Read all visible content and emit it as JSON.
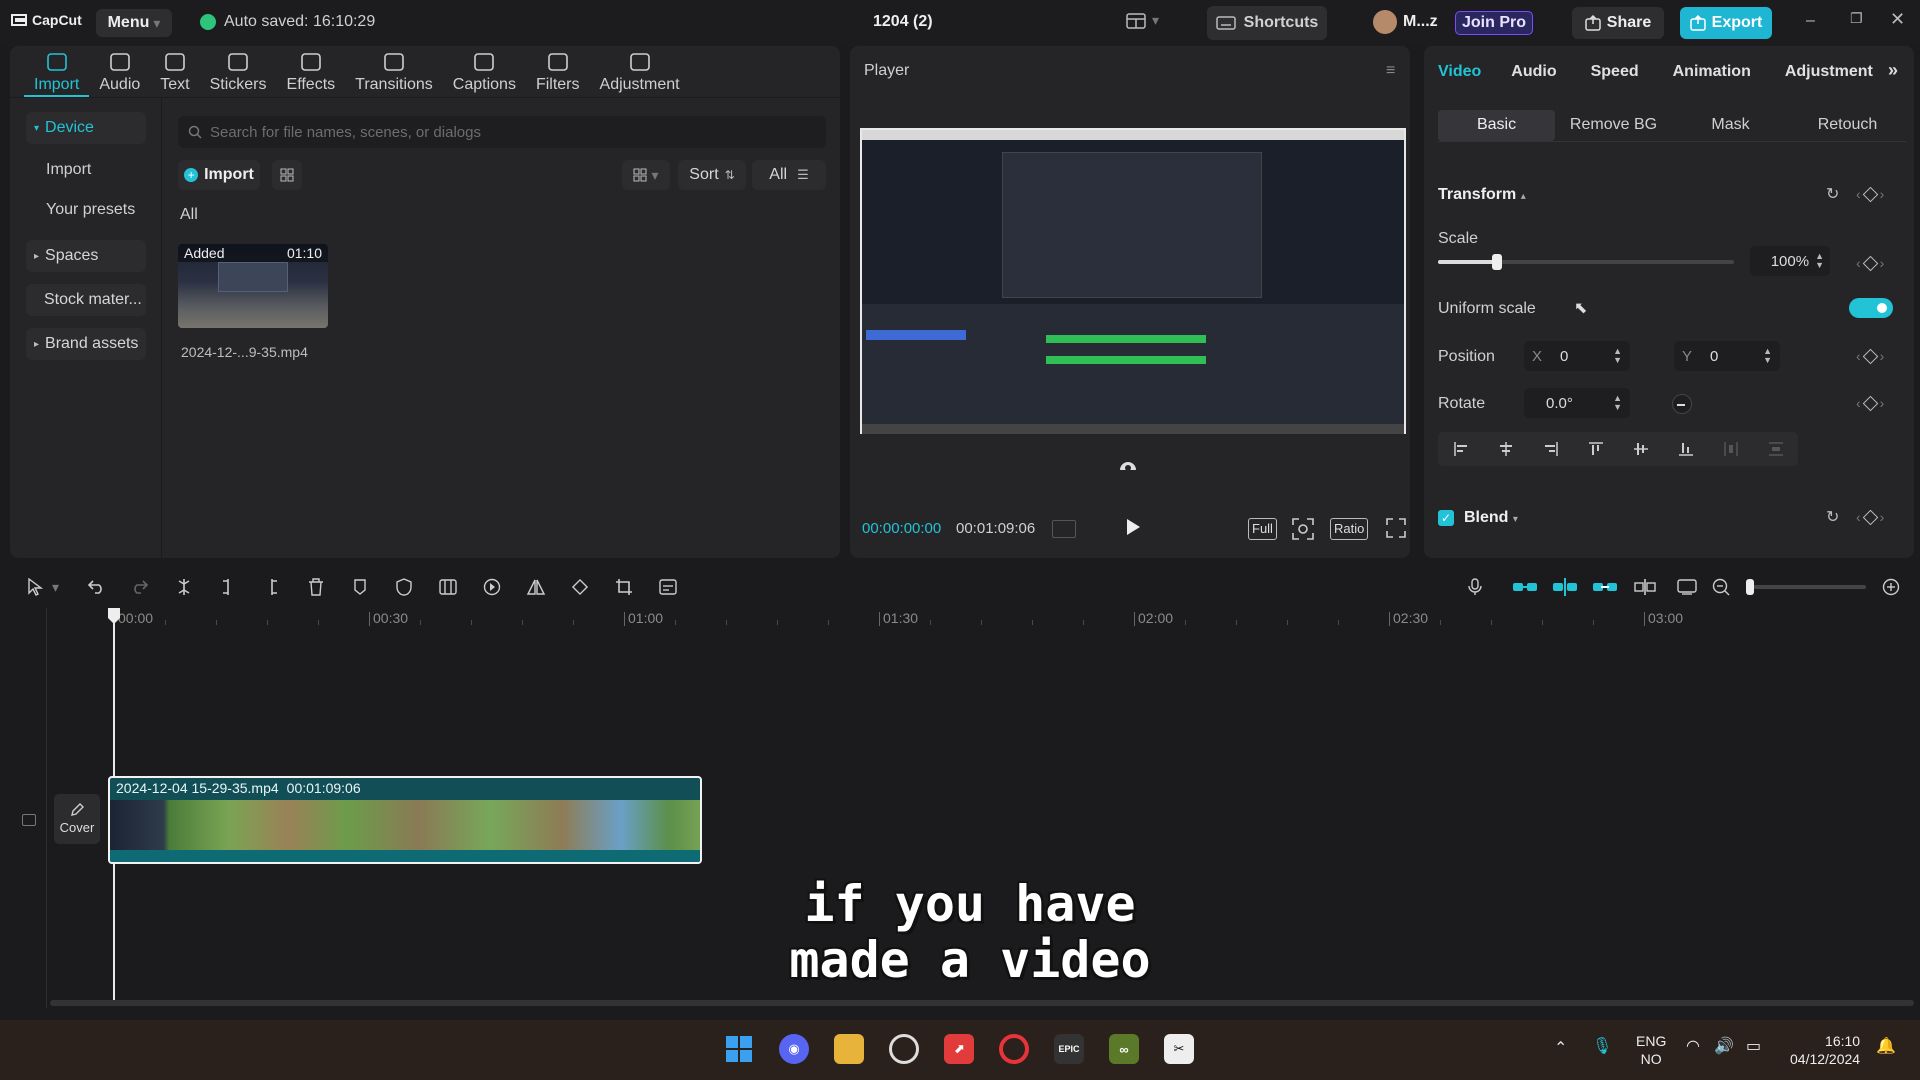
{
  "titlebar": {
    "app_name": "CapCut",
    "menu_label": "Menu",
    "autosave": "Auto saved: 16:10:29",
    "project_name": "1204 (2)",
    "shortcuts": "Shortcuts",
    "user": "M...z",
    "join_pro": "Join Pro",
    "share": "Share",
    "export": "Export"
  },
  "media_toolbar": [
    {
      "label": "Import",
      "icon": "import-icon"
    },
    {
      "label": "Audio",
      "icon": "audio-icon"
    },
    {
      "label": "Text",
      "icon": "text-icon"
    },
    {
      "label": "Stickers",
      "icon": "stickers-icon"
    },
    {
      "label": "Effects",
      "icon": "effects-icon"
    },
    {
      "label": "Transitions",
      "icon": "transitions-icon"
    },
    {
      "label": "Captions",
      "icon": "captions-icon"
    },
    {
      "label": "Filters",
      "icon": "filters-icon"
    },
    {
      "label": "Adjustment",
      "icon": "adjustment-icon"
    }
  ],
  "media_sidebar": {
    "device": "Device",
    "import": "Import",
    "presets": "Your presets",
    "spaces": "Spaces",
    "stock": "Stock mater...",
    "brand": "Brand assets"
  },
  "media": {
    "search_placeholder": "Search for file names, scenes, or dialogs",
    "import_button": "Import",
    "sort": "Sort",
    "all_filter": "All",
    "section_all": "All",
    "clip": {
      "badge": "Added",
      "duration": "01:10",
      "name": "2024-12-...9-35.mp4"
    }
  },
  "player": {
    "title": "Player",
    "current_time": "00:00:00:00",
    "total_time": "00:01:09:06",
    "full": "Full",
    "ratio": "Ratio"
  },
  "inspector": {
    "tabs": [
      "Video",
      "Audio",
      "Speed",
      "Animation",
      "Adjustment"
    ],
    "subtabs": [
      "Basic",
      "Remove BG",
      "Mask",
      "Retouch"
    ],
    "transform": "Transform",
    "scale_label": "Scale",
    "scale_value": "100%",
    "scale_fraction": 0.2,
    "uniform_scale": "Uniform scale",
    "position_label": "Position",
    "x_label": "X",
    "x_value": "0",
    "y_label": "Y",
    "y_value": "0",
    "rotate_label": "Rotate",
    "rotate_value": "0.0°",
    "blend": "Blend"
  },
  "timeline": {
    "ruler": [
      "00:00",
      "00:30",
      "01:00",
      "01:30",
      "02:00",
      "02:30",
      "03:00"
    ],
    "clip_name": "2024-12-04 15-29-35.mp4",
    "clip_duration": "00:01:09:06",
    "cover": "Cover"
  },
  "subtitle": {
    "line1": "if you have",
    "line2": "made a video"
  },
  "taskbar": {
    "lang1": "ENG",
    "lang2": "NO",
    "time": "16:10",
    "date": "04/12/2024"
  },
  "colors": {
    "accent": "#22c3d6",
    "export": "#1fb6d3",
    "join_pro": "#7b4dff"
  }
}
